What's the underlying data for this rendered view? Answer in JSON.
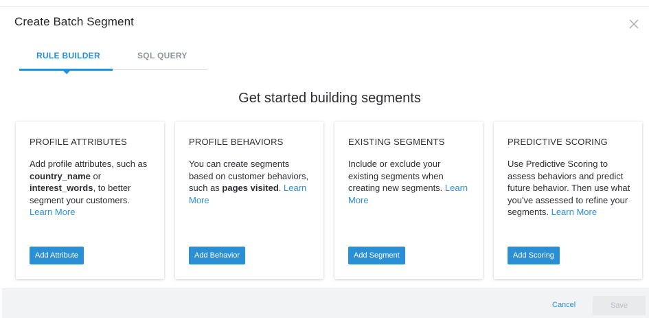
{
  "dialog": {
    "title": "Create Batch Segment"
  },
  "tabs": [
    {
      "label": "RULE BUILDER",
      "active": true
    },
    {
      "label": "SQL QUERY",
      "active": false
    }
  ],
  "headline": "Get started building segments",
  "cards": [
    {
      "title": "PROFILE ATTRIBUTES",
      "desc": [
        {
          "t": "Add profile attributes, such as "
        },
        {
          "t": "country_name",
          "b": true
        },
        {
          "t": " or "
        },
        {
          "t": "interest_words",
          "b": true
        },
        {
          "t": ", to better segment your customers. "
        },
        {
          "t": "Learn More",
          "link": true
        }
      ],
      "button": "Add Attribute"
    },
    {
      "title": "PROFILE BEHAVIORS",
      "desc": [
        {
          "t": "You can create segments based on customer behaviors, such as "
        },
        {
          "t": "pages visited",
          "b": true
        },
        {
          "t": ". "
        },
        {
          "t": "Learn More",
          "link": true
        }
      ],
      "button": "Add Behavior"
    },
    {
      "title": "EXISTING SEGMENTS",
      "desc": [
        {
          "t": "Include or exclude your existing segments when creating new segments. "
        },
        {
          "t": "Learn More",
          "link": true
        }
      ],
      "button": "Add Segment"
    },
    {
      "title": "PREDICTIVE SCORING",
      "desc": [
        {
          "t": "Use Predictive Scoring to assess behaviors and predict future behavior. Then use what you've assessed to refine your segments. "
        },
        {
          "t": "Learn More",
          "link": true
        }
      ],
      "button": "Add Scoring"
    }
  ],
  "footer": {
    "cancel": "Cancel",
    "save": "Save"
  },
  "colors": {
    "accent": "#2b8fd6",
    "footer_bg": "#f2f3f4",
    "disabled": "#e8eaec"
  }
}
